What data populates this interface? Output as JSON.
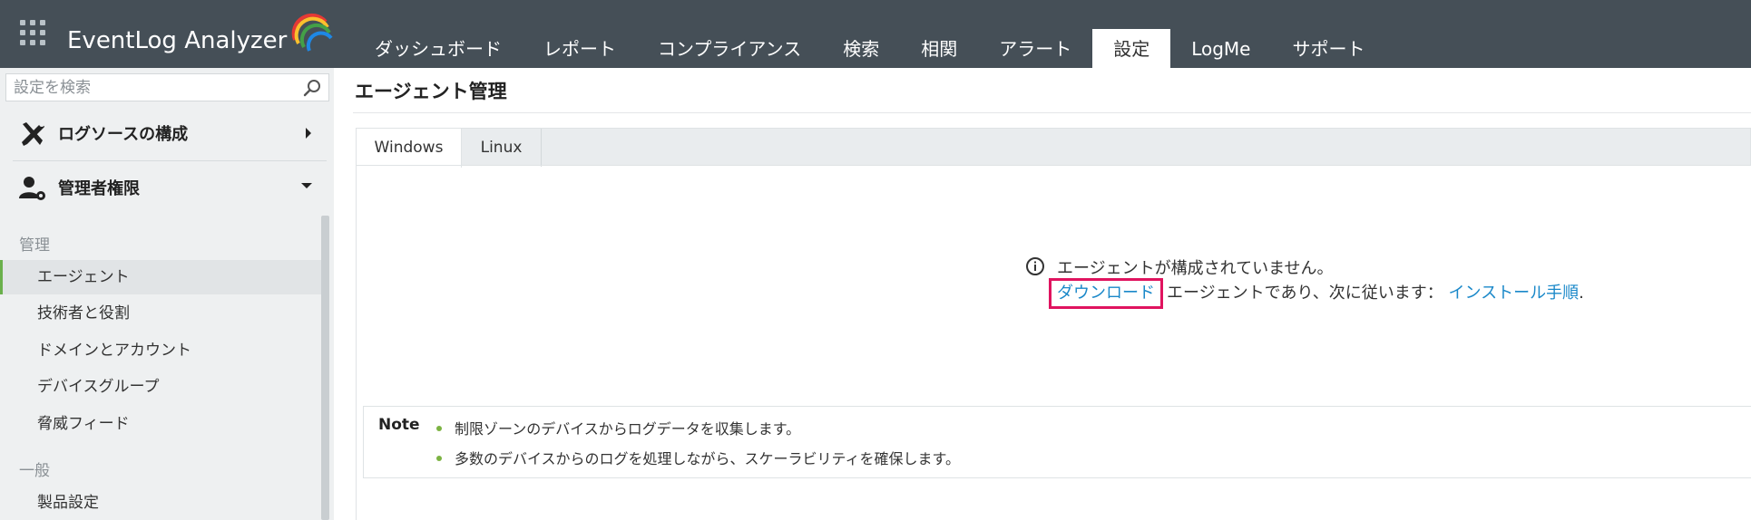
{
  "app": {
    "logo_text": "EventLog Analyzer",
    "nav_tabs": [
      {
        "label": "ダッシュボード"
      },
      {
        "label": "レポート"
      },
      {
        "label": "コンプライアンス"
      },
      {
        "label": "検索"
      },
      {
        "label": "相関"
      },
      {
        "label": "アラート"
      },
      {
        "label": "設定",
        "active": true
      },
      {
        "label": "LogMe"
      },
      {
        "label": "サポート"
      }
    ]
  },
  "sidebar": {
    "search_placeholder": "設定を検索",
    "sections": [
      {
        "label": "ログソースの構成"
      },
      {
        "label": "管理者権限"
      }
    ],
    "groups": [
      {
        "label": "管理",
        "items": [
          {
            "label": "エージェント",
            "active": true
          },
          {
            "label": "技術者と役割"
          },
          {
            "label": "ドメインとアカウント"
          },
          {
            "label": "デバイスグループ"
          },
          {
            "label": "脅威フィード"
          }
        ]
      },
      {
        "label": "一般",
        "items": [
          {
            "label": "製品設定"
          }
        ]
      }
    ]
  },
  "main": {
    "title": "エージェント管理",
    "tabs": [
      {
        "label": "Windows",
        "active": true
      },
      {
        "label": "Linux"
      }
    ],
    "empty_message": "エージェントが構成されていません。",
    "download_link": "ダウンロード",
    "middle_text": "エージェントであり、次に従います：",
    "install_link": "インストール手順",
    "trailing_period": ".",
    "note": {
      "label": "Note",
      "items": [
        "制限ゾーンのデバイスからログデータを収集します。",
        "多数のデバイスからのログを処理しながら、スケーラビリティを確保します。"
      ]
    }
  },
  "colors": {
    "topbar": "#454f57",
    "link": "#1a88c9",
    "highlight_box": "#e0135f",
    "active_indicator": "#6ab04c"
  }
}
